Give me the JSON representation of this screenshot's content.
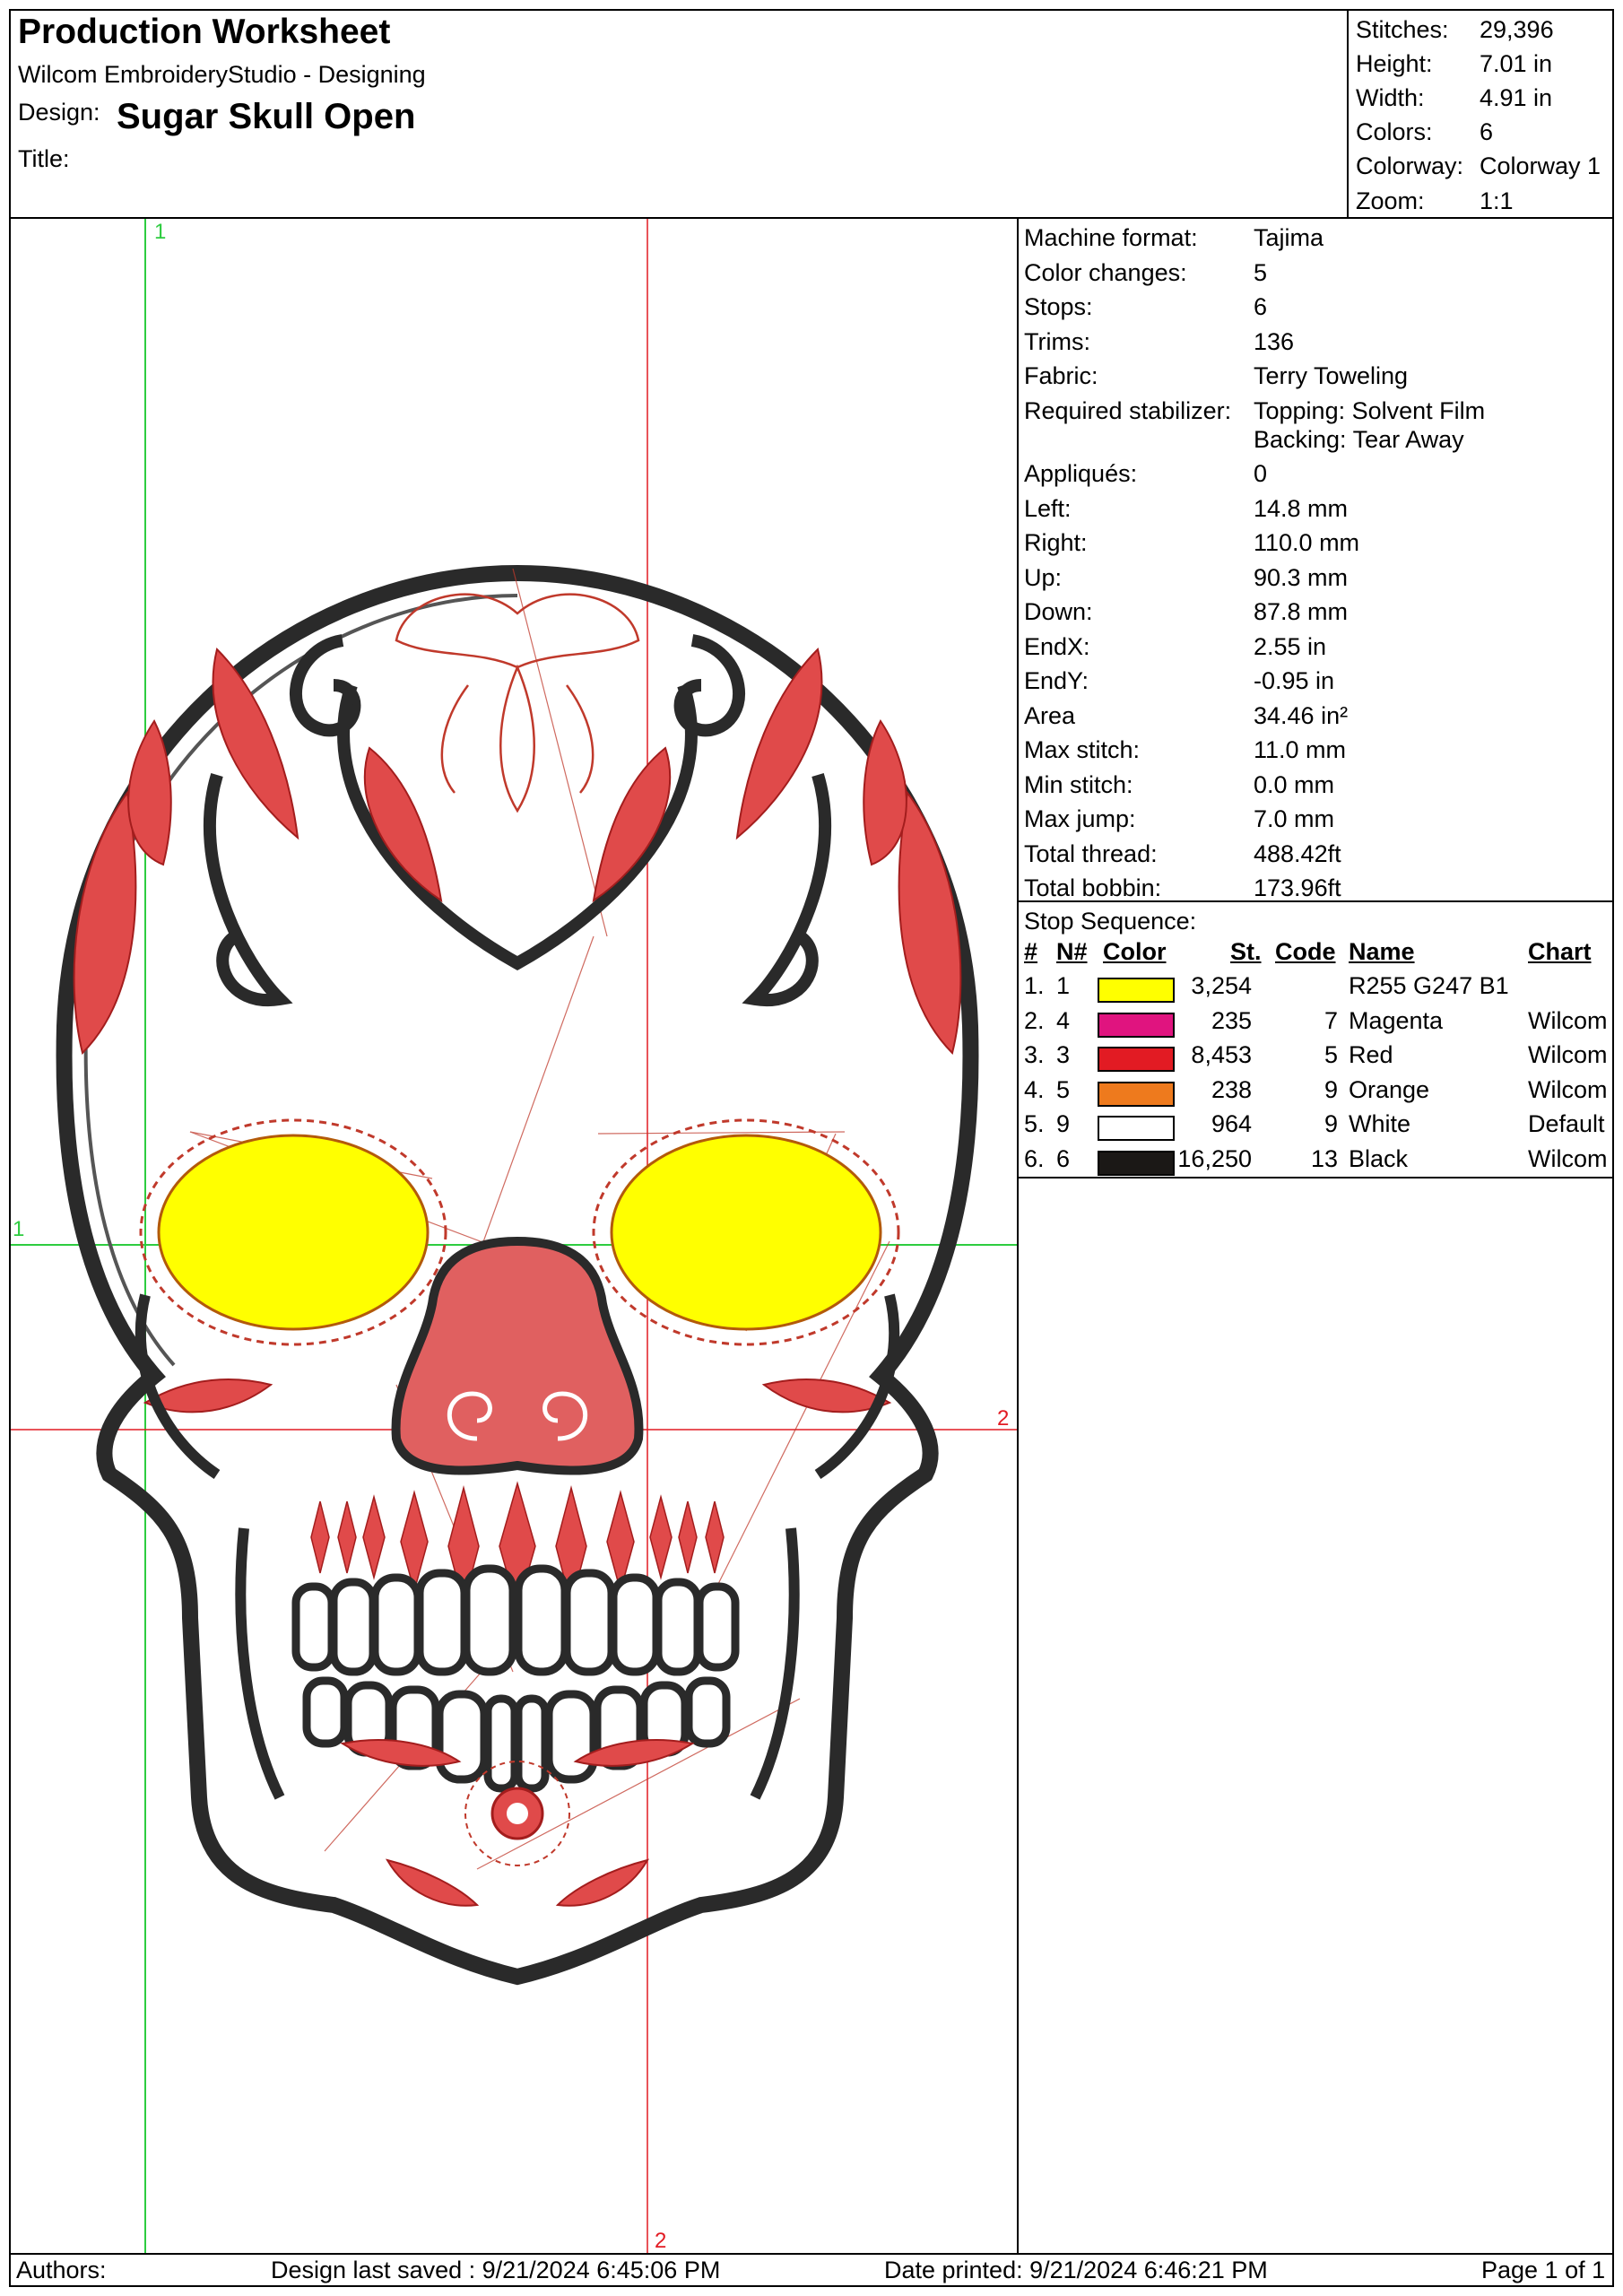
{
  "header": {
    "title": "Production Worksheet",
    "software": "Wilcom EmbroideryStudio - Designing",
    "design_label": "Design:",
    "design_name": "Sugar Skull Open",
    "title_label": "Title:",
    "summary": [
      {
        "k": "Stitches:",
        "v": "29,396"
      },
      {
        "k": "Height:",
        "v": "7.01 in"
      },
      {
        "k": "Width:",
        "v": "4.91 in"
      },
      {
        "k": "Colors:",
        "v": "6"
      },
      {
        "k": "Colorway:",
        "v": "Colorway 1"
      },
      {
        "k": "Zoom:",
        "v": "1:1"
      }
    ]
  },
  "guides": {
    "vertical_1": "1",
    "horizontal_1": "1",
    "vertical_2": "2",
    "horizontal_2": "2"
  },
  "info": [
    {
      "k": "Machine format:",
      "v": "Tajima"
    },
    {
      "k": "Color changes:",
      "v": "5"
    },
    {
      "k": "Stops:",
      "v": "6"
    },
    {
      "k": "Trims:",
      "v": "136"
    },
    {
      "k": "Fabric:",
      "v": "Terry Toweling"
    },
    {
      "k": "Required stabilizer:",
      "v": "Topping: Solvent Film",
      "v2": "Backing: Tear Away"
    },
    {
      "k": "Appliqués:",
      "v": "0"
    },
    {
      "k": "Left:",
      "v": "14.8 mm"
    },
    {
      "k": "Right:",
      "v": "110.0 mm"
    },
    {
      "k": "Up:",
      "v": "90.3 mm"
    },
    {
      "k": "Down:",
      "v": "87.8 mm"
    },
    {
      "k": "EndX:",
      "v": "2.55 in"
    },
    {
      "k": "EndY:",
      "v": "-0.95 in"
    },
    {
      "k": "Area",
      "v": " 34.46 in²"
    },
    {
      "k": "Max stitch:",
      "v": "11.0 mm"
    },
    {
      "k": "Min stitch:",
      "v": "0.0 mm"
    },
    {
      "k": "Max jump:",
      "v": "7.0 mm"
    },
    {
      "k": "Total thread:",
      "v": "488.42ft"
    },
    {
      "k": "Total bobbin:",
      "v": "173.96ft"
    }
  ],
  "stop_sequence": {
    "title": "Stop Sequence:",
    "headers": {
      "idx": "#",
      "n": "N#",
      "color": "Color",
      "st": "St.",
      "code": "Code",
      "name": "Name",
      "chart": "Chart"
    },
    "rows": [
      {
        "idx": "1.",
        "n": "1",
        "swatch": "#ffff00",
        "st": "3,254",
        "code": "",
        "name": "R255 G247 B1",
        "chart": ""
      },
      {
        "idx": "2.",
        "n": "4",
        "swatch": "#e0147f",
        "st": "235",
        "code": "7",
        "name": "Magenta",
        "chart": "Wilcom"
      },
      {
        "idx": "3.",
        "n": "3",
        "swatch": "#e21b23",
        "st": "8,453",
        "code": "5",
        "name": "Red",
        "chart": "Wilcom"
      },
      {
        "idx": "4.",
        "n": "5",
        "swatch": "#ee7a1d",
        "st": "238",
        "code": "9",
        "name": "Orange",
        "chart": "Wilcom"
      },
      {
        "idx": "5.",
        "n": "9",
        "swatch": "#ffffff",
        "st": "964",
        "code": "9",
        "name": "White",
        "chart": "Default"
      },
      {
        "idx": "6.",
        "n": "6",
        "swatch": "#1b1816",
        "st": "16,250",
        "code": "13",
        "name": "Black",
        "chart": "Wilcom"
      }
    ]
  },
  "footer": {
    "authors": "Authors:",
    "saved": "Design last saved : 9/21/2024 6:45:06 PM",
    "printed": "Date printed: 9/21/2024 6:46:21 PM",
    "page": "Page 1 of 1"
  },
  "colors": {
    "yellow": "#ffff00",
    "red": "#e21b23",
    "black": "#2a2a2a",
    "guide_green": "#2ecc40",
    "guide_red": "#e21b23"
  }
}
